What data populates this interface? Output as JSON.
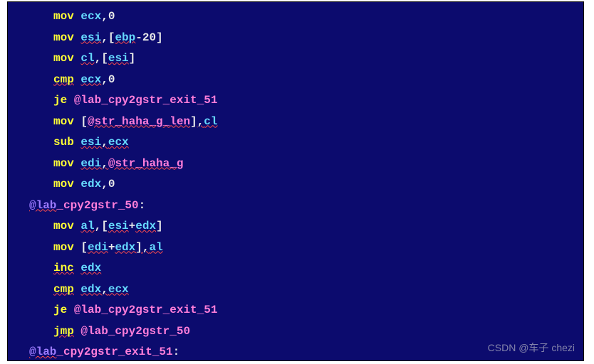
{
  "code": {
    "ops": {
      "mov": "mov",
      "cmp": "cmp",
      "je": "je",
      "sub": "sub",
      "inc": "inc",
      "jmp": "jmp"
    },
    "regs": {
      "ecx": "ecx",
      "esi": "esi",
      "ebp": "ebp",
      "cl": "cl",
      "edi": "edi",
      "edx": "edx",
      "al": "al"
    },
    "nums": {
      "zero": "0",
      "twenty": "20"
    },
    "punct": {
      "comma": ",",
      "lbr": "[",
      "rbr": "]",
      "minus": "-",
      "plus": "+",
      "colon": ":",
      "at": "@"
    },
    "labels": {
      "exit51": "@lab_cpy2gstr_exit_51",
      "loop50": "@lab_cpy2gstr_50",
      "haha_len": "@str_haha_g_len",
      "haha_g": "@str_haha_g",
      "lab_prefix": "@lab",
      "loop50_suffix": "_cpy2gstr_50",
      "exit51_suffix": "_cpy2gstr_exit_51"
    }
  },
  "watermark": "CSDN @车子 chezi"
}
